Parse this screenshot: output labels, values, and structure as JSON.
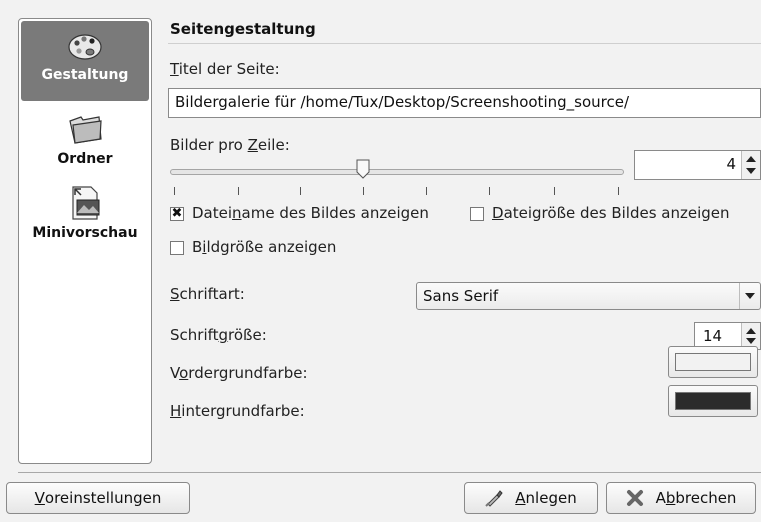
{
  "sidebar": {
    "items": [
      {
        "label": "Gestaltung",
        "icon": "palette-icon",
        "active": true
      },
      {
        "label": "Ordner",
        "icon": "folder-icon",
        "active": false
      },
      {
        "label": "Minivorschau",
        "icon": "image-preview-icon",
        "active": false
      }
    ]
  },
  "page": {
    "section_title": "Seitengestaltung",
    "title_label_u": "T",
    "title_label_rest": "itel der Seite:",
    "title_value": "Bildergalerie für /home/Tux/Desktop/Screenshooting_source/",
    "per_row_label_a": "Bilder pro ",
    "per_row_label_u": "Z",
    "per_row_label_b": "eile:",
    "per_row_value": "4",
    "show_filename": {
      "checked": true,
      "mark": "✖",
      "label_a": "Datei",
      "label_u": "n",
      "label_b": "ame des Bildes anzeigen"
    },
    "show_filesize": {
      "checked": false,
      "mark": "",
      "label_u": "D",
      "label_b": "ateigröße des Bildes anzeigen"
    },
    "show_imagesize": {
      "checked": false,
      "mark": "",
      "label_a": "B",
      "label_u": "i",
      "label_b": "ldgröße anzeigen"
    },
    "font_label_u": "S",
    "font_label_b": "chriftart:",
    "font_value": "Sans Serif",
    "fontsize_label_a": "Schrift",
    "fontsize_label_u": "g",
    "fontsize_label_b": "röße:",
    "fontsize_value": "14",
    "fg_label_a": "V",
    "fg_label_u": "o",
    "fg_label_b": "rdergrundfarbe:",
    "fg_color": "#f2f2f2",
    "bg_label_u": "H",
    "bg_label_b": "intergrundfarbe:",
    "bg_color": "#2b2b2b"
  },
  "buttons": {
    "defaults_u": "V",
    "defaults_b": "oreinstellungen",
    "create_u": "A",
    "create_b": "nlegen",
    "cancel_a": "A",
    "cancel_u": "b",
    "cancel_b": "brechen"
  }
}
